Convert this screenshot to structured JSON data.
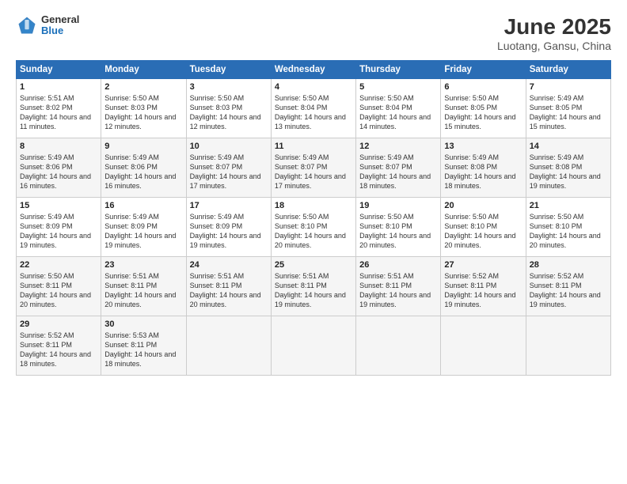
{
  "header": {
    "logo_general": "General",
    "logo_blue": "Blue",
    "title": "June 2025",
    "subtitle": "Luotang, Gansu, China"
  },
  "days_of_week": [
    "Sunday",
    "Monday",
    "Tuesday",
    "Wednesday",
    "Thursday",
    "Friday",
    "Saturday"
  ],
  "weeks": [
    [
      {
        "day": "1",
        "sunrise": "5:51 AM",
        "sunset": "8:02 PM",
        "daylight": "14 hours and 11 minutes."
      },
      {
        "day": "2",
        "sunrise": "5:50 AM",
        "sunset": "8:03 PM",
        "daylight": "14 hours and 12 minutes."
      },
      {
        "day": "3",
        "sunrise": "5:50 AM",
        "sunset": "8:03 PM",
        "daylight": "14 hours and 12 minutes."
      },
      {
        "day": "4",
        "sunrise": "5:50 AM",
        "sunset": "8:04 PM",
        "daylight": "14 hours and 13 minutes."
      },
      {
        "day": "5",
        "sunrise": "5:50 AM",
        "sunset": "8:04 PM",
        "daylight": "14 hours and 14 minutes."
      },
      {
        "day": "6",
        "sunrise": "5:50 AM",
        "sunset": "8:05 PM",
        "daylight": "14 hours and 15 minutes."
      },
      {
        "day": "7",
        "sunrise": "5:49 AM",
        "sunset": "8:05 PM",
        "daylight": "14 hours and 15 minutes."
      }
    ],
    [
      {
        "day": "8",
        "sunrise": "5:49 AM",
        "sunset": "8:06 PM",
        "daylight": "14 hours and 16 minutes."
      },
      {
        "day": "9",
        "sunrise": "5:49 AM",
        "sunset": "8:06 PM",
        "daylight": "14 hours and 16 minutes."
      },
      {
        "day": "10",
        "sunrise": "5:49 AM",
        "sunset": "8:07 PM",
        "daylight": "14 hours and 17 minutes."
      },
      {
        "day": "11",
        "sunrise": "5:49 AM",
        "sunset": "8:07 PM",
        "daylight": "14 hours and 17 minutes."
      },
      {
        "day": "12",
        "sunrise": "5:49 AM",
        "sunset": "8:07 PM",
        "daylight": "14 hours and 18 minutes."
      },
      {
        "day": "13",
        "sunrise": "5:49 AM",
        "sunset": "8:08 PM",
        "daylight": "14 hours and 18 minutes."
      },
      {
        "day": "14",
        "sunrise": "5:49 AM",
        "sunset": "8:08 PM",
        "daylight": "14 hours and 19 minutes."
      }
    ],
    [
      {
        "day": "15",
        "sunrise": "5:49 AM",
        "sunset": "8:09 PM",
        "daylight": "14 hours and 19 minutes."
      },
      {
        "day": "16",
        "sunrise": "5:49 AM",
        "sunset": "8:09 PM",
        "daylight": "14 hours and 19 minutes."
      },
      {
        "day": "17",
        "sunrise": "5:49 AM",
        "sunset": "8:09 PM",
        "daylight": "14 hours and 19 minutes."
      },
      {
        "day": "18",
        "sunrise": "5:50 AM",
        "sunset": "8:10 PM",
        "daylight": "14 hours and 20 minutes."
      },
      {
        "day": "19",
        "sunrise": "5:50 AM",
        "sunset": "8:10 PM",
        "daylight": "14 hours and 20 minutes."
      },
      {
        "day": "20",
        "sunrise": "5:50 AM",
        "sunset": "8:10 PM",
        "daylight": "14 hours and 20 minutes."
      },
      {
        "day": "21",
        "sunrise": "5:50 AM",
        "sunset": "8:10 PM",
        "daylight": "14 hours and 20 minutes."
      }
    ],
    [
      {
        "day": "22",
        "sunrise": "5:50 AM",
        "sunset": "8:11 PM",
        "daylight": "14 hours and 20 minutes."
      },
      {
        "day": "23",
        "sunrise": "5:51 AM",
        "sunset": "8:11 PM",
        "daylight": "14 hours and 20 minutes."
      },
      {
        "day": "24",
        "sunrise": "5:51 AM",
        "sunset": "8:11 PM",
        "daylight": "14 hours and 20 minutes."
      },
      {
        "day": "25",
        "sunrise": "5:51 AM",
        "sunset": "8:11 PM",
        "daylight": "14 hours and 19 minutes."
      },
      {
        "day": "26",
        "sunrise": "5:51 AM",
        "sunset": "8:11 PM",
        "daylight": "14 hours and 19 minutes."
      },
      {
        "day": "27",
        "sunrise": "5:52 AM",
        "sunset": "8:11 PM",
        "daylight": "14 hours and 19 minutes."
      },
      {
        "day": "28",
        "sunrise": "5:52 AM",
        "sunset": "8:11 PM",
        "daylight": "14 hours and 19 minutes."
      }
    ],
    [
      {
        "day": "29",
        "sunrise": "5:52 AM",
        "sunset": "8:11 PM",
        "daylight": "14 hours and 18 minutes."
      },
      {
        "day": "30",
        "sunrise": "5:53 AM",
        "sunset": "8:11 PM",
        "daylight": "14 hours and 18 minutes."
      },
      null,
      null,
      null,
      null,
      null
    ]
  ]
}
